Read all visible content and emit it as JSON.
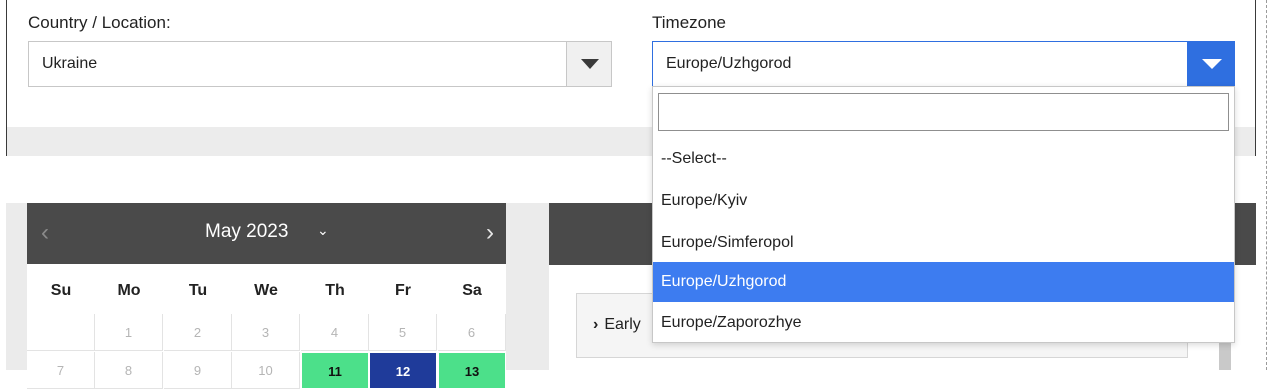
{
  "form": {
    "country_label": "Country / Location:",
    "country_value": "Ukraine",
    "timezone_label": "Timezone",
    "timezone_value": "Europe/Uzhgorod"
  },
  "timezone_dropdown": {
    "search_value": "",
    "options": [
      "--Select--",
      "Europe/Kyiv",
      "Europe/Simferopol",
      "Europe/Uzhgorod",
      "Europe/Zaporozhye"
    ],
    "selected": "Europe/Uzhgorod"
  },
  "calendar": {
    "month_label": "May 2023",
    "prev_glyph": "‹",
    "next_glyph": "›",
    "month_chevron": "⌄",
    "weekdays": [
      "Su",
      "Mo",
      "Tu",
      "We",
      "Th",
      "Fr",
      "Sa"
    ],
    "week1": [
      "",
      "1",
      "2",
      "3",
      "4",
      "5",
      "6"
    ],
    "week2": [
      "7",
      "8",
      "9",
      "10",
      "11",
      "12",
      "13"
    ]
  },
  "times_panel": {
    "accordion_label": "Early",
    "accordion_chevron": "›"
  },
  "colors": {
    "accent_blue": "#2f6fe0",
    "selected_option": "#3d7cf0",
    "selected_day": "#1f3b9a",
    "available_day": "#4ce08a",
    "calendar_header": "#4a4a4a"
  }
}
